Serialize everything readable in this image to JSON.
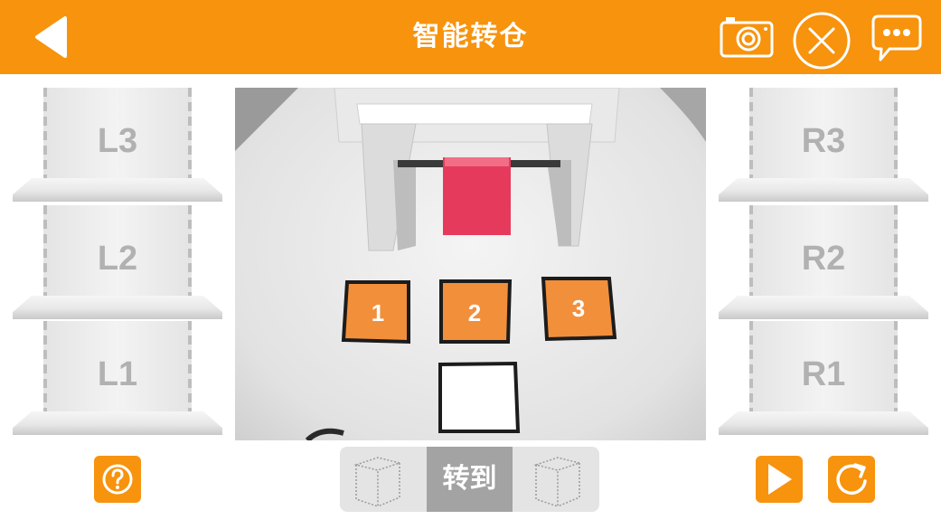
{
  "header": {
    "title": "智能转仓",
    "icons": [
      "back-arrow-icon",
      "camera-icon",
      "close-circle-icon",
      "chat-bubble-icon"
    ]
  },
  "shelves": {
    "left": [
      {
        "label": "L3"
      },
      {
        "label": "L2"
      },
      {
        "label": "L1"
      }
    ],
    "right": [
      {
        "label": "R3"
      },
      {
        "label": "R2"
      },
      {
        "label": "R1"
      }
    ]
  },
  "camera_view": {
    "pads": [
      "1",
      "2",
      "3"
    ],
    "object": "red-cube"
  },
  "controls": {
    "goto_label": "转到",
    "icons": [
      "help-icon",
      "cube-icon",
      "cube-icon",
      "play-icon",
      "reset-icon"
    ]
  },
  "colors": {
    "accent": "#f7930d",
    "goto_button": "#a3a3a3",
    "shelf_label": "#b1b1b1"
  }
}
